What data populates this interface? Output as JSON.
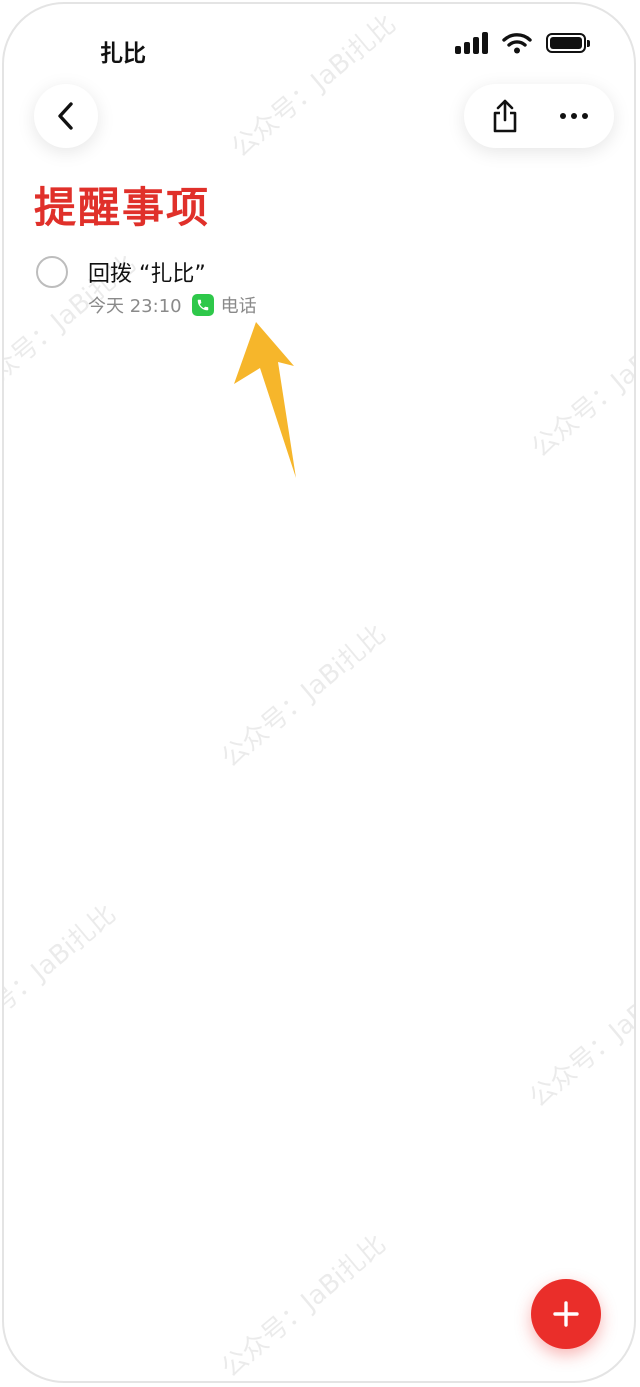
{
  "status_bar": {
    "app_label": "扎比"
  },
  "toolbar": {
    "back_icon": "chevron-left-icon",
    "share_icon": "share-icon",
    "more_icon": "more-horizontal-icon"
  },
  "list": {
    "title": "提醒事项",
    "accent_color": "#e0302a",
    "items": [
      {
        "title": "回拨 “扎比”",
        "time": "今天 23:10",
        "badge_icon": "phone-icon",
        "badge_color": "#2ec84a",
        "badge_label": "电话"
      }
    ]
  },
  "watermark": {
    "text": "公众号：JaBi扎比"
  },
  "fab": {
    "icon": "plus-icon",
    "color": "#ea2e2a"
  },
  "annotation": {
    "arrow_color": "#f6b62b"
  }
}
